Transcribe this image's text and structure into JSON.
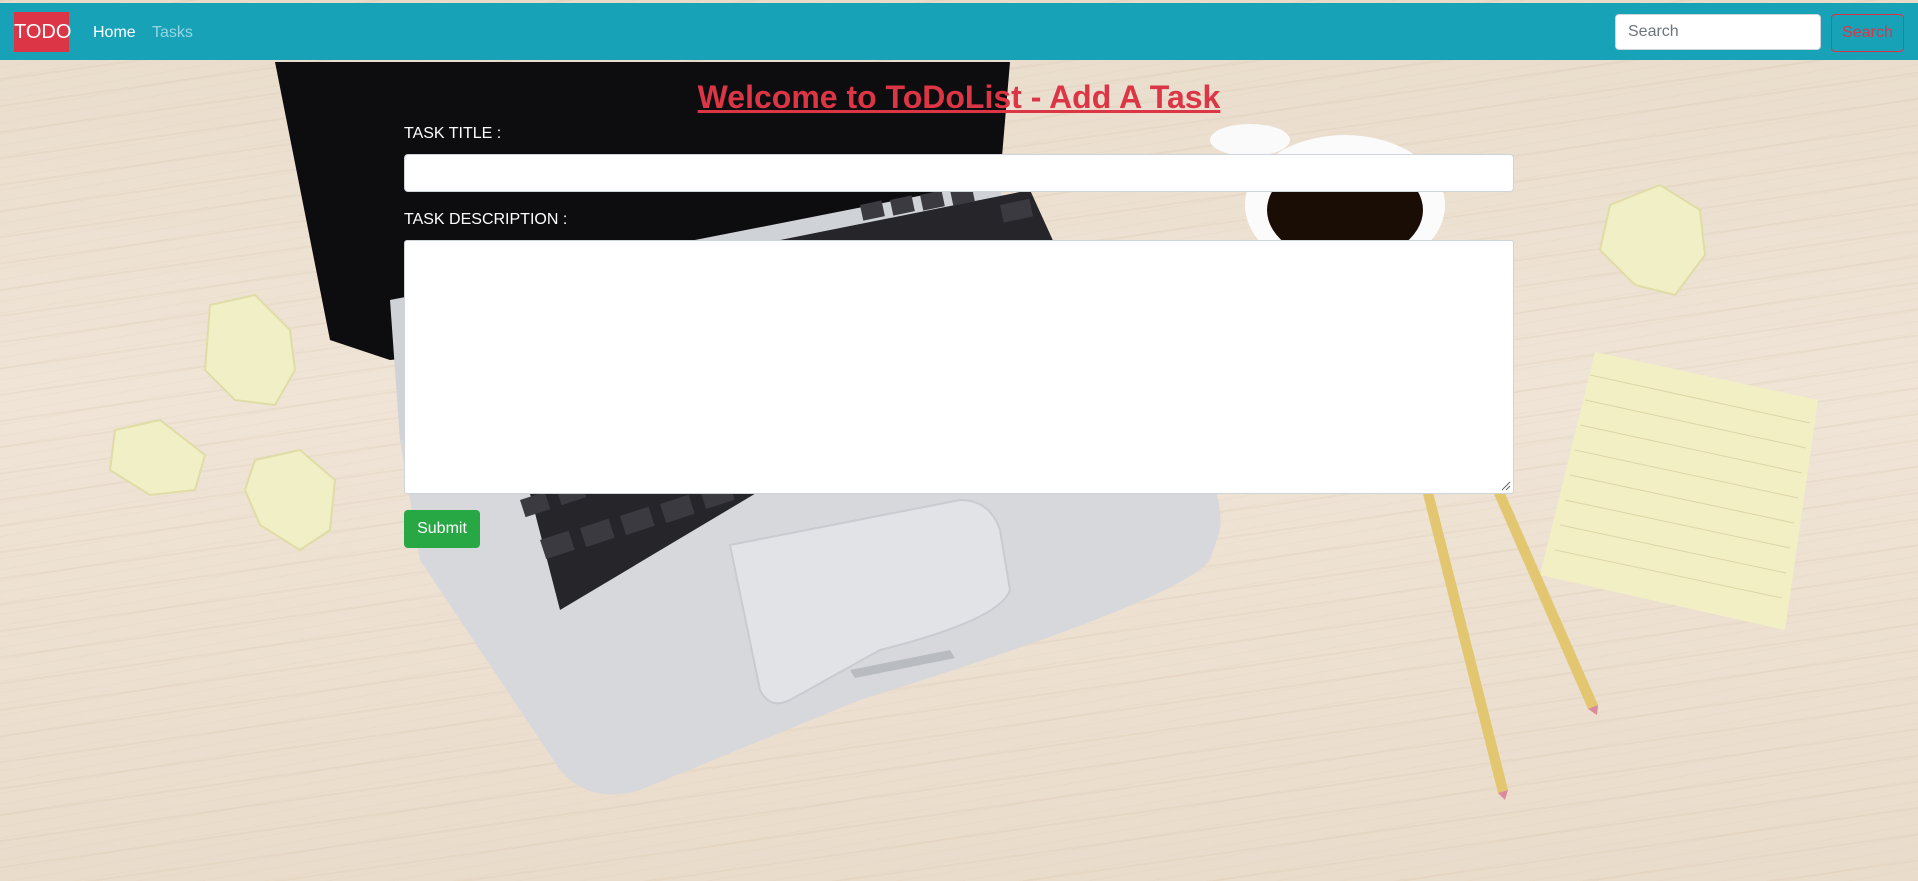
{
  "navbar": {
    "brand": "TODO",
    "links": [
      {
        "label": "Home",
        "active": true
      },
      {
        "label": "Tasks",
        "active": false
      }
    ],
    "search": {
      "placeholder": "Search",
      "value": "",
      "button_label": "Search"
    },
    "background_color": "#17a2b8",
    "brand_color": "#dc3545"
  },
  "main": {
    "title": "Welcome to ToDoList - Add A Task",
    "form": {
      "title_label": "TASK TITLE :",
      "title_value": "",
      "description_label": "TASK DESCRIPTION :",
      "description_value": "",
      "submit_label": "Submit"
    },
    "title_color": "#dc3545",
    "submit_color": "#28a745"
  },
  "background": {
    "description_icons": [
      "laptop-icon",
      "coffee-cup-icon",
      "sticky-note-icon",
      "pencil-icon",
      "crumpled-paper-icon"
    ]
  }
}
